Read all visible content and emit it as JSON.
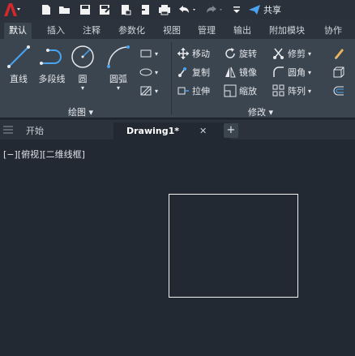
{
  "quick_access": {
    "share_label": "共享",
    "icons": [
      "app-logo",
      "new-icon",
      "open-icon",
      "save-icon",
      "save-as-icon",
      "open-web-icon",
      "save-web-icon",
      "plot-icon",
      "undo-icon",
      "redo-icon",
      "customize-icon",
      "share-icon"
    ]
  },
  "ribbon_tabs": [
    "默认",
    "插入",
    "注释",
    "参数化",
    "视图",
    "管理",
    "输出",
    "附加模块",
    "协作"
  ],
  "draw_panel": {
    "title": "绘图",
    "buttons": [
      "直线",
      "多段线",
      "圆",
      "圆弧"
    ]
  },
  "modify_panel": {
    "title": "修改",
    "buttons": [
      "移动",
      "旋转",
      "修剪",
      "复制",
      "镜像",
      "圆角",
      "拉伸",
      "缩放",
      "阵列"
    ]
  },
  "document_tabs": [
    "开始",
    "Drawing1*"
  ],
  "viewport": {
    "label": "[−][俯视][二维线框]"
  },
  "colors": {
    "background": "#222933",
    "ribbon": "#3b4550",
    "accent": "#4aa3f0",
    "logo_red": "#d6272b"
  }
}
